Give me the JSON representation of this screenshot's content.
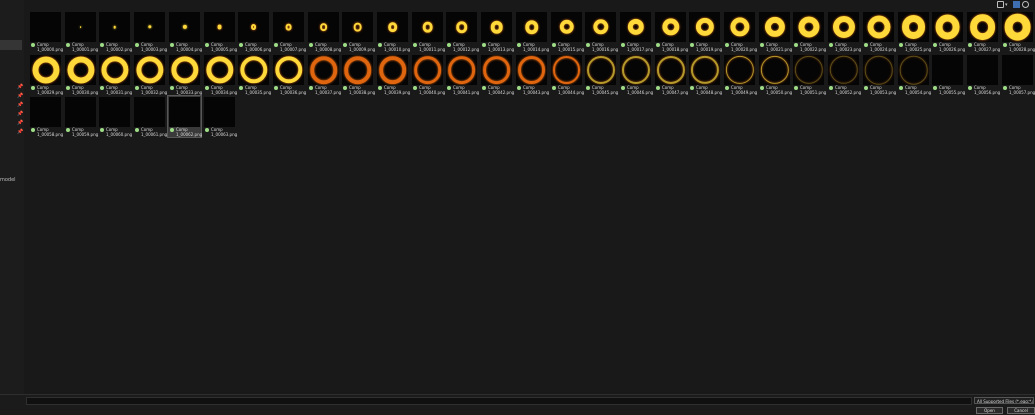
{
  "sidebar": {
    "partial_label": "model",
    "pins": [
      "pin-icon",
      "pin-icon",
      "pin-icon",
      "pin-icon",
      "pin-icon",
      "pin-icon"
    ]
  },
  "topbar": {
    "icons": [
      "view-options-icon",
      "chevron-down-icon",
      "preview-pane-icon",
      "help-icon"
    ]
  },
  "files": [
    {
      "name": "Comp\n1_00000.png",
      "frame": 0
    },
    {
      "name": "Comp\n1_00001.png",
      "frame": 1
    },
    {
      "name": "Comp\n1_00002.png",
      "frame": 2
    },
    {
      "name": "Comp\n1_00003.png",
      "frame": 3
    },
    {
      "name": "Comp\n1_00004.png",
      "frame": 4
    },
    {
      "name": "Comp\n1_00005.png",
      "frame": 5
    },
    {
      "name": "Comp\n1_00006.png",
      "frame": 6
    },
    {
      "name": "Comp\n1_00007.png",
      "frame": 7
    },
    {
      "name": "Comp\n1_00008.png",
      "frame": 8
    },
    {
      "name": "Comp\n1_00009.png",
      "frame": 9
    },
    {
      "name": "Comp\n1_00010.png",
      "frame": 10
    },
    {
      "name": "Comp\n1_00011.png",
      "frame": 11
    },
    {
      "name": "Comp\n1_00012.png",
      "frame": 12
    },
    {
      "name": "Comp\n1_00013.png",
      "frame": 13
    },
    {
      "name": "Comp\n1_00014.png",
      "frame": 14
    },
    {
      "name": "Comp\n1_00015.png",
      "frame": 15
    },
    {
      "name": "Comp\n1_00016.png",
      "frame": 16
    },
    {
      "name": "Comp\n1_00017.png",
      "frame": 17
    },
    {
      "name": "Comp\n1_00018.png",
      "frame": 18
    },
    {
      "name": "Comp\n1_00019.png",
      "frame": 19
    },
    {
      "name": "Comp\n1_00020.png",
      "frame": 20
    },
    {
      "name": "Comp\n1_00021.png",
      "frame": 21
    },
    {
      "name": "Comp\n1_00022.png",
      "frame": 22
    },
    {
      "name": "Comp\n1_00023.png",
      "frame": 23
    },
    {
      "name": "Comp\n1_00024.png",
      "frame": 24
    },
    {
      "name": "Comp\n1_00025.png",
      "frame": 25
    },
    {
      "name": "Comp\n1_00026.png",
      "frame": 26
    },
    {
      "name": "Comp\n1_00027.png",
      "frame": 27
    },
    {
      "name": "Comp\n1_00028.png",
      "frame": 28
    },
    {
      "name": "Comp\n1_00029.png",
      "frame": 29
    },
    {
      "name": "Comp\n1_00030.png",
      "frame": 30
    },
    {
      "name": "Comp\n1_00031.png",
      "frame": 31
    },
    {
      "name": "Comp\n1_00032.png",
      "frame": 32
    },
    {
      "name": "Comp\n1_00033.png",
      "frame": 33
    },
    {
      "name": "Comp\n1_00034.png",
      "frame": 34
    },
    {
      "name": "Comp\n1_00035.png",
      "frame": 35
    },
    {
      "name": "Comp\n1_00036.png",
      "frame": 36
    },
    {
      "name": "Comp\n1_00037.png",
      "frame": 37
    },
    {
      "name": "Comp\n1_00038.png",
      "frame": 38
    },
    {
      "name": "Comp\n1_00039.png",
      "frame": 39
    },
    {
      "name": "Comp\n1_00040.png",
      "frame": 40
    },
    {
      "name": "Comp\n1_00041.png",
      "frame": 41
    },
    {
      "name": "Comp\n1_00042.png",
      "frame": 42
    },
    {
      "name": "Comp\n1_00043.png",
      "frame": 43
    },
    {
      "name": "Comp\n1_00044.png",
      "frame": 44
    },
    {
      "name": "Comp\n1_00045.png",
      "frame": 45
    },
    {
      "name": "Comp\n1_00046.png",
      "frame": 46
    },
    {
      "name": "Comp\n1_00047.png",
      "frame": 47
    },
    {
      "name": "Comp\n1_00048.png",
      "frame": 48
    },
    {
      "name": "Comp\n1_00049.png",
      "frame": 49
    },
    {
      "name": "Comp\n1_00050.png",
      "frame": 50
    },
    {
      "name": "Comp\n1_00051.png",
      "frame": 51
    },
    {
      "name": "Comp\n1_00052.png",
      "frame": 52
    },
    {
      "name": "Comp\n1_00053.png",
      "frame": 53
    },
    {
      "name": "Comp\n1_00054.png",
      "frame": 54
    },
    {
      "name": "Comp\n1_00055.png",
      "frame": 55
    },
    {
      "name": "Comp\n1_00056.png",
      "frame": 56
    },
    {
      "name": "Comp\n1_00057.png",
      "frame": 57
    },
    {
      "name": "Comp\n1_00058.png",
      "frame": 58
    },
    {
      "name": "Comp\n1_00059.png",
      "frame": 59
    },
    {
      "name": "Comp\n1_00060.png",
      "frame": 60
    },
    {
      "name": "Comp\n1_00061.png",
      "frame": 61
    },
    {
      "name": "Comp\n1_00062.png",
      "frame": 62,
      "selected": true
    },
    {
      "name": "Comp\n1_00063.png",
      "frame": 63
    }
  ],
  "footer": {
    "file_type_filter": "All Supported Files (*.egg;*.mp",
    "open_label": "Open",
    "cancel_label": "Cancel"
  },
  "colors": {
    "fire_core": "#ffd93a",
    "fire_edge": "#e0650f",
    "file_status_dot": "#9fdc87",
    "accent": "#3f6fb3"
  }
}
